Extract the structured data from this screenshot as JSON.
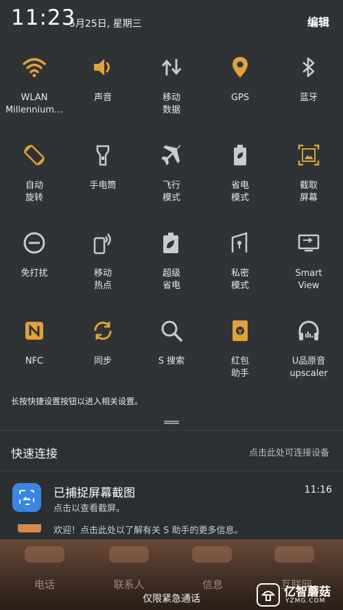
{
  "status": {
    "time": "11:23",
    "date": "5月25日, 星期三",
    "edit_label": "编辑"
  },
  "colors": {
    "accent": "#e0a23a",
    "icon_off": "#c8ccd0",
    "background": "#2f3336",
    "notification_app": "#3a86e0"
  },
  "tiles": [
    {
      "label": "WLAN\nMillennium…",
      "icon": "wifi-icon",
      "active": true
    },
    {
      "label": "声音",
      "icon": "volume-icon",
      "active": true
    },
    {
      "label": "移动\n数据",
      "icon": "mobile-data-icon",
      "active": false
    },
    {
      "label": "GPS",
      "icon": "location-pin-icon",
      "active": true
    },
    {
      "label": "蓝牙",
      "icon": "bluetooth-icon",
      "active": false
    },
    {
      "label": "自动\n旋转",
      "icon": "auto-rotate-icon",
      "active": true
    },
    {
      "label": "手电筒",
      "icon": "flashlight-icon",
      "active": false
    },
    {
      "label": "飞行\n模式",
      "icon": "airplane-icon",
      "active": false
    },
    {
      "label": "省电\n模式",
      "icon": "battery-saver-icon",
      "active": false
    },
    {
      "label": "截取\n屏幕",
      "icon": "screenshot-icon",
      "active": true
    },
    {
      "label": "免打扰",
      "icon": "do-not-disturb-icon",
      "active": false
    },
    {
      "label": "移动\n热点",
      "icon": "hotspot-icon",
      "active": false
    },
    {
      "label": "超级\n省电",
      "icon": "ultra-power-saving-icon",
      "active": false
    },
    {
      "label": "私密\n模式",
      "icon": "private-mode-icon",
      "active": false
    },
    {
      "label": "Smart\nView",
      "icon": "smart-view-icon",
      "active": false
    },
    {
      "label": "NFC",
      "icon": "nfc-icon",
      "active": true
    },
    {
      "label": "同步",
      "icon": "sync-icon",
      "active": true
    },
    {
      "label": "S 搜索",
      "icon": "search-icon",
      "active": false
    },
    {
      "label": "红包\n助手",
      "icon": "red-packet-icon",
      "active": true
    },
    {
      "label": "U品原音\nupscaler",
      "icon": "headphones-icon",
      "active": false
    }
  ],
  "hint": "长按快捷设置按钮以进入相关设置。",
  "quick_connect": {
    "title": "快速连接",
    "hint": "点击此处可连接设备"
  },
  "notification": {
    "title": "已捕捉屏幕截图",
    "text": "点击以查看截屏。",
    "time": "11:16"
  },
  "notification2": {
    "text": "欢迎！点击此处以了解有关 S 助手的更多信息。"
  },
  "dock": [
    {
      "label": "电话"
    },
    {
      "label": "联系人"
    },
    {
      "label": "信息"
    },
    {
      "label": "互联网"
    }
  ],
  "emergency": "仅限紧急通话",
  "watermark": {
    "name": "亿智蘑菇",
    "domain": "YZMG.COM"
  }
}
